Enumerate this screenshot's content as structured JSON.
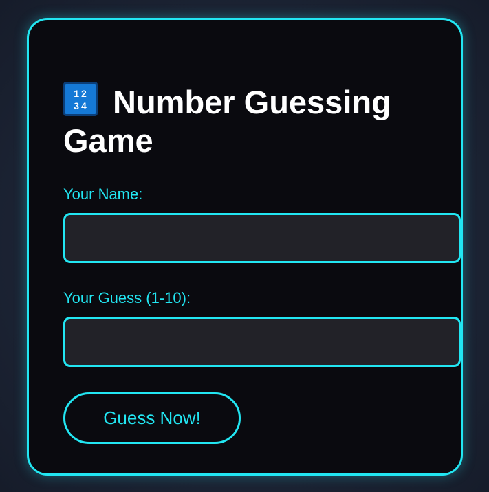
{
  "game": {
    "title": "Number Guessing Game",
    "title_icon": "input-numbers-icon",
    "icon_digits_row1": "12",
    "icon_digits_row2": "34"
  },
  "form": {
    "name_label": "Your Name:",
    "name_value": "",
    "name_placeholder": "",
    "guess_label": "Your Guess (1-10):",
    "guess_value": "",
    "guess_placeholder": "",
    "submit_label": "Guess Now!"
  },
  "colors": {
    "accent": "#22e6f2",
    "card_background": "#0a0a0f",
    "input_background": "#222228",
    "page_background": "#1d2536",
    "title_text": "#ffffff"
  }
}
